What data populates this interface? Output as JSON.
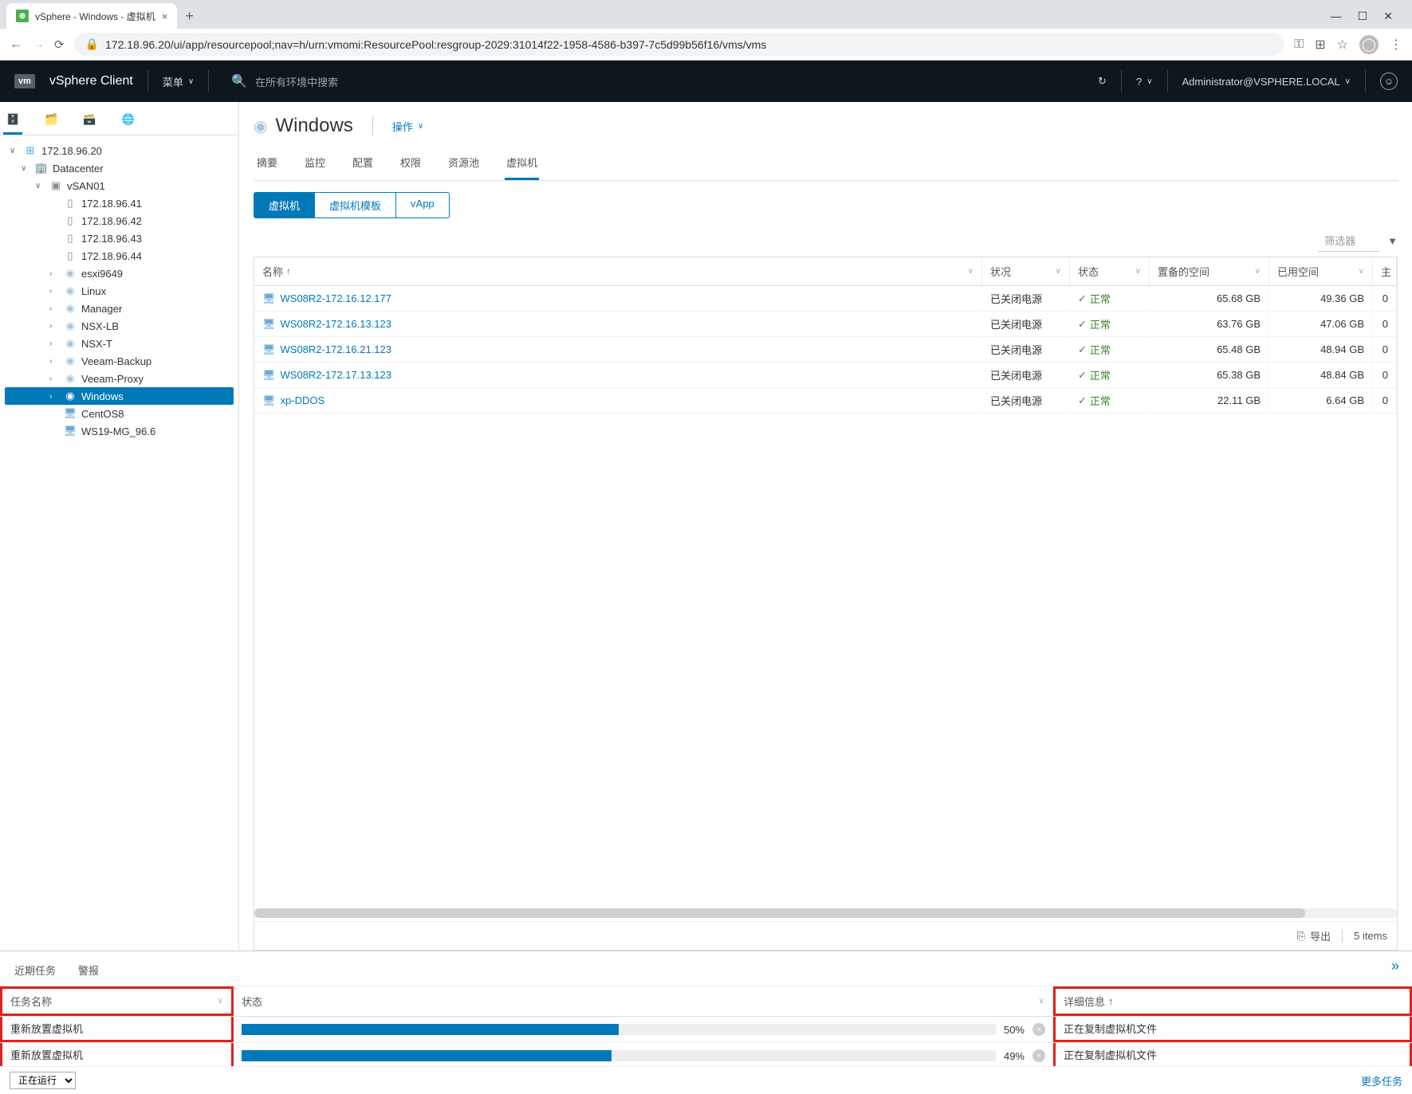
{
  "browser": {
    "tab_title": "vSphere - Windows - 虚拟机",
    "url": "172.18.96.20/ui/app/resourcepool;nav=h/urn:vmomi:ResourcePool:resgroup-2029:31014f22-1958-4586-b397-7c5d99b56f16/vms/vms"
  },
  "header": {
    "product": "vSphere Client",
    "menu": "菜单",
    "search_placeholder": "在所有环境中搜索",
    "user": "Administrator@VSPHERE.LOCAL"
  },
  "tree": {
    "root": "172.18.96.20",
    "datacenter": "Datacenter",
    "cluster": "vSAN01",
    "hosts": [
      "172.18.96.41",
      "172.18.96.42",
      "172.18.96.43",
      "172.18.96.44"
    ],
    "pools": [
      "esxi9649",
      "Linux",
      "Manager",
      "NSX-LB",
      "NSX-T",
      "Veeam-Backup",
      "Veeam-Proxy",
      "Windows"
    ],
    "vms": [
      "CentOS8",
      "WS19-MG_96.6"
    ]
  },
  "content": {
    "title": "Windows",
    "actions": "操作",
    "tabs": [
      "摘要",
      "监控",
      "配置",
      "权限",
      "资源池",
      "虚拟机"
    ],
    "subtabs": [
      "虚拟机",
      "虚拟机模板",
      "vApp"
    ],
    "filter_placeholder": "筛选器",
    "columns": {
      "name": "名称",
      "status": "状况",
      "state": "状态",
      "provisioned": "置备的空间",
      "used": "已用空间",
      "last": "主"
    },
    "state_label": "正常",
    "rows": [
      {
        "name": "WS08R2-172.16.12.177",
        "status": "已关闭电源",
        "prov": "65.68 GB",
        "used": "49.36 GB",
        "last": "0"
      },
      {
        "name": "WS08R2-172.16.13.123",
        "status": "已关闭电源",
        "prov": "63.76 GB",
        "used": "47.06 GB",
        "last": "0"
      },
      {
        "name": "WS08R2-172.16.21.123",
        "status": "已关闭电源",
        "prov": "65.48 GB",
        "used": "48.94 GB",
        "last": "0"
      },
      {
        "name": "WS08R2-172.17.13.123",
        "status": "已关闭电源",
        "prov": "65.38 GB",
        "used": "48.84 GB",
        "last": "0"
      },
      {
        "name": "xp-DDOS",
        "status": "已关闭电源",
        "prov": "22.11 GB",
        "used": "6.64 GB",
        "last": "0"
      }
    ],
    "export": "导出",
    "items_count": "5 items"
  },
  "tasks": {
    "tab_recent": "近期任务",
    "tab_alerts": "警报",
    "col_name": "任务名称",
    "col_status": "状态",
    "col_detail": "详细信息",
    "rows": [
      {
        "name": "重新放置虚拟机",
        "pct": "50%",
        "pct_w": 50,
        "detail": "正在复制虚拟机文件"
      },
      {
        "name": "重新放置虚拟机",
        "pct": "49%",
        "pct_w": 49,
        "detail": "正在复制虚拟机文件"
      }
    ],
    "running": "正在运行",
    "more": "更多任务"
  }
}
